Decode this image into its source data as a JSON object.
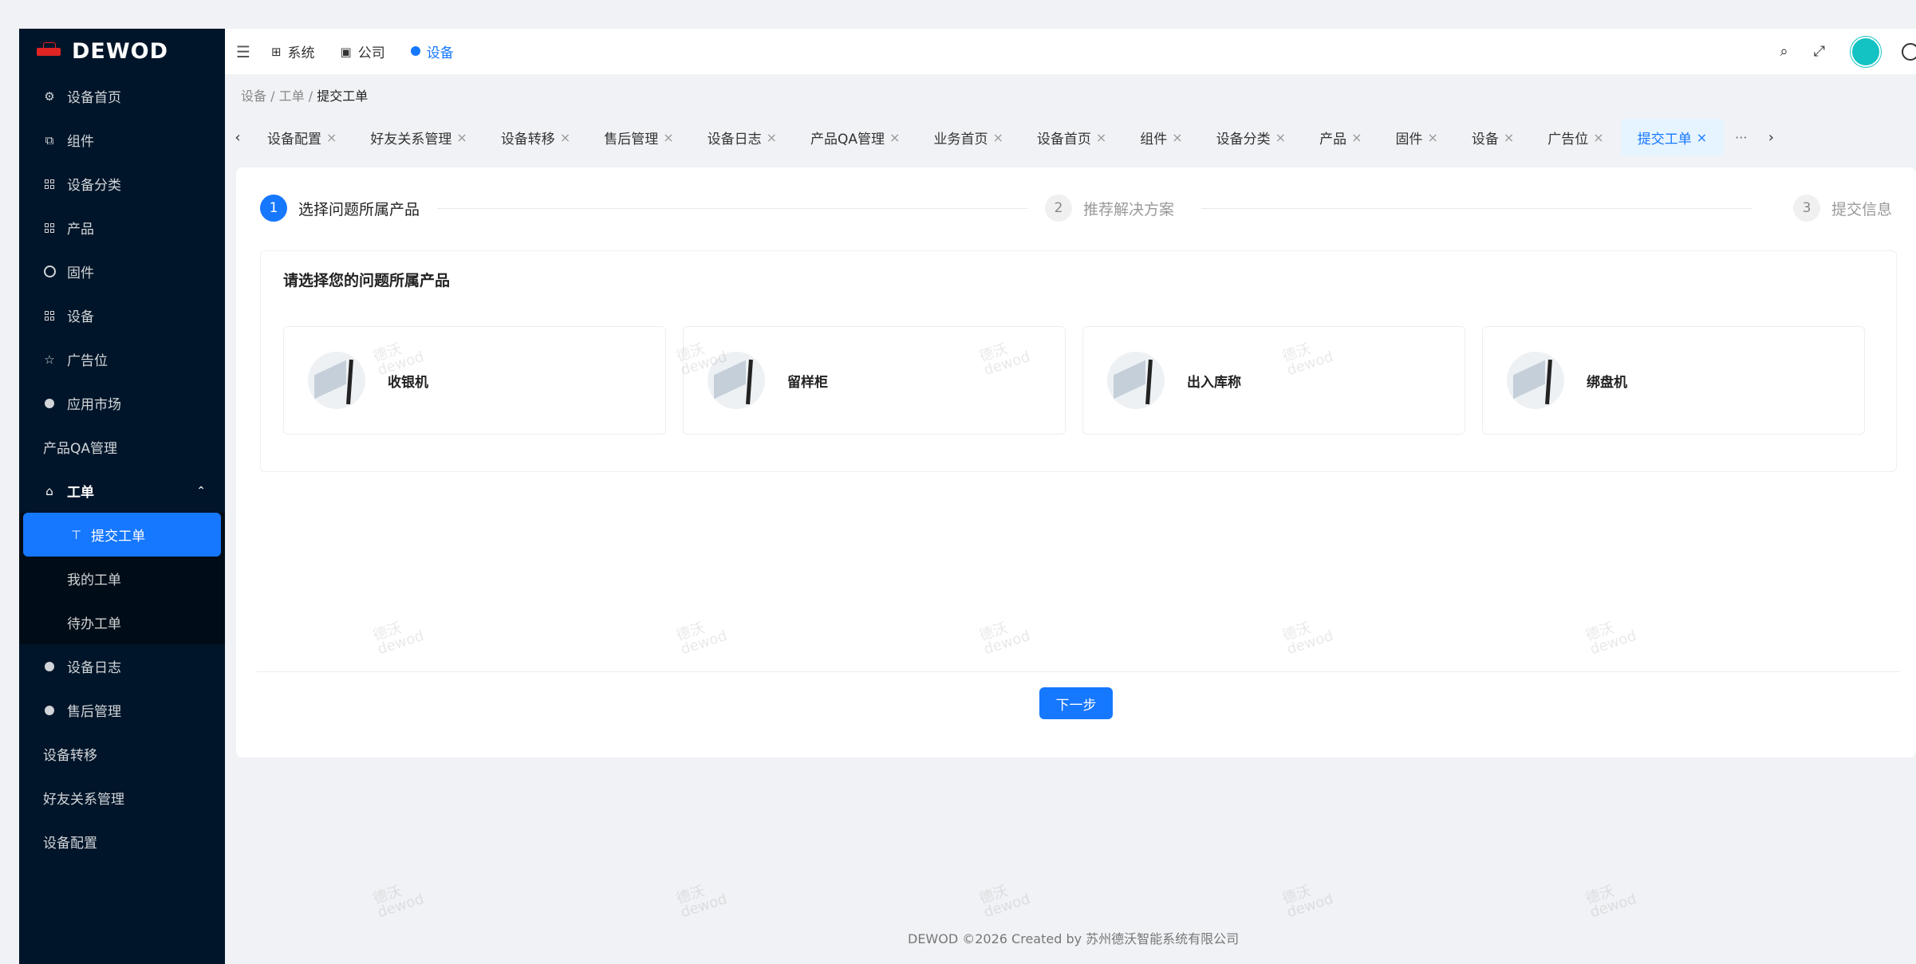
{
  "app": {
    "brand": "DEWOD"
  },
  "sidebar": {
    "items": [
      {
        "label": "设备首页",
        "icon": "gear-icon"
      },
      {
        "label": "组件",
        "icon": "component-icon"
      },
      {
        "label": "设备分类",
        "icon": "grid-icon"
      },
      {
        "label": "产品",
        "icon": "grid-icon"
      },
      {
        "label": "固件",
        "icon": "chip-icon"
      },
      {
        "label": "设备",
        "icon": "grid-icon"
      },
      {
        "label": "广告位",
        "icon": "star-icon"
      },
      {
        "label": "应用市场",
        "icon": "android-icon"
      },
      {
        "label": "产品QA管理",
        "icon": ""
      }
    ],
    "group": {
      "label": "工单",
      "icon": "ticket-icon",
      "chevron": "chevron-up-icon"
    },
    "sub_items": [
      {
        "label": "提交工单",
        "icon": "upload-icon"
      },
      {
        "label": "我的工单"
      },
      {
        "label": "待办工单"
      }
    ],
    "bottom_items": [
      {
        "label": "设备日志",
        "icon": "log-icon"
      },
      {
        "label": "售后管理",
        "icon": "android-icon"
      },
      {
        "label": "设备转移"
      },
      {
        "label": "好友关系管理"
      },
      {
        "label": "设备配置"
      }
    ]
  },
  "header": {
    "nav": [
      {
        "label": "系统",
        "icon": "system-icon"
      },
      {
        "label": "公司",
        "icon": "company-icon"
      },
      {
        "label": "设备",
        "icon": "android-icon"
      }
    ],
    "right_icons": [
      "search-icon",
      "fullscreen-icon",
      "avatar",
      "globe-icon"
    ]
  },
  "breadcrumb": {
    "items": [
      "设备",
      "工单",
      "提交工单"
    ],
    "sep": "/"
  },
  "tabs": [
    "设备配置",
    "好友关系管理",
    "设备转移",
    "售后管理",
    "设备日志",
    "产品QA管理",
    "业务首页",
    "设备首页",
    "组件",
    "设备分类",
    "产品",
    "固件",
    "设备",
    "广告位",
    "提交工单"
  ],
  "tab_more": "···",
  "steps": [
    {
      "num": "1",
      "label": "选择问题所属产品"
    },
    {
      "num": "2",
      "label": "推荐解决方案"
    },
    {
      "num": "3",
      "label": "提交信息"
    }
  ],
  "section": {
    "title": "请选择您的问题所属产品"
  },
  "products": [
    "收银机",
    "留样柜",
    "出入库称",
    "绑盘机"
  ],
  "next_button": "下一步",
  "footer": "DEWOD ©2026 Created by 苏州德沃智能系统有限公司",
  "watermark": {
    "line1": "德沃",
    "line2": "dewod"
  },
  "colors": {
    "primary": "#1677ff",
    "sidebar_bg": "#001529",
    "avatar": "#13c2c2"
  }
}
